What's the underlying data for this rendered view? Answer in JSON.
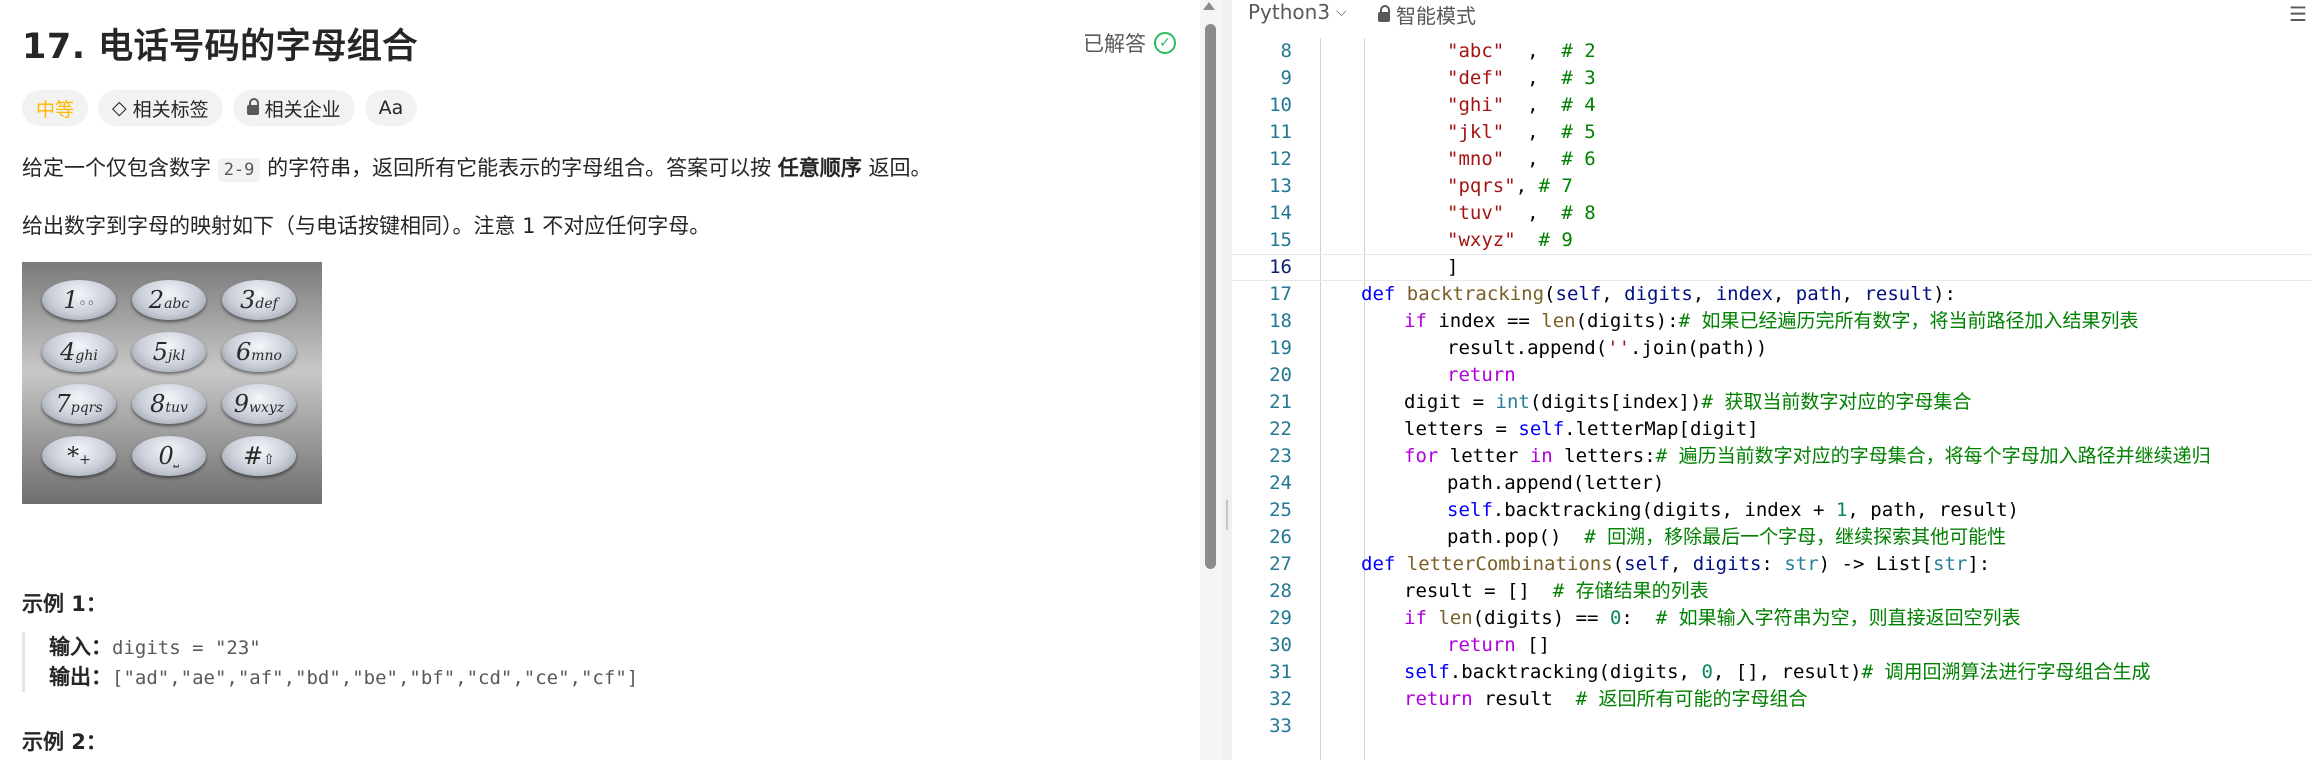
{
  "problem": {
    "title": "17. 电话号码的字母组合",
    "solved_label": "已解答",
    "tags": [
      "中等",
      "相关标签",
      "相关企业",
      "Aa"
    ],
    "description_parts": [
      "给定一个仅包含数字 ",
      "2-9",
      " 的字符串，返回所有它能表示的字母组合。答案可以按 ",
      "任意顺序",
      " 返回。"
    ],
    "mapping_note": "给出数字到字母的映射如下（与电话按键相同）。注意 1 不对应任何字母。",
    "keypad": [
      {
        "n": "1",
        "l": "◦◦"
      },
      {
        "n": "2",
        "l": "abc"
      },
      {
        "n": "3",
        "l": "def"
      },
      {
        "n": "4",
        "l": "ghi"
      },
      {
        "n": "5",
        "l": "jkl"
      },
      {
        "n": "6",
        "l": "mno"
      },
      {
        "n": "7",
        "l": "pqrs"
      },
      {
        "n": "8",
        "l": "tuv"
      },
      {
        "n": "9",
        "l": "wxyz"
      },
      {
        "n": "*",
        "l": "+"
      },
      {
        "n": "0",
        "l": "⎵"
      },
      {
        "n": "#",
        "l": "⇧"
      }
    ],
    "example1_title": "示例 1：",
    "example1_input_label": "输入：",
    "example1_input_value": "digits = \"23\"",
    "example1_output_label": "输出：",
    "example1_output_value": "[\"ad\",\"ae\",\"af\",\"bd\",\"be\",\"bf\",\"cd\",\"ce\",\"cf\"]",
    "example2_title": "示例 2："
  },
  "editor": {
    "language": "Python3",
    "mode_label": "智能模式",
    "current_line": 16,
    "lines": [
      {
        "no": 8,
        "indent": 3,
        "tokens": [
          [
            "str",
            "\"abc\""
          ],
          [
            "",
            "  ,  "
          ],
          [
            "cm",
            "# 2"
          ]
        ]
      },
      {
        "no": 9,
        "indent": 3,
        "tokens": [
          [
            "str",
            "\"def\""
          ],
          [
            "",
            "  ,  "
          ],
          [
            "cm",
            "# 3"
          ]
        ]
      },
      {
        "no": 10,
        "indent": 3,
        "tokens": [
          [
            "str",
            "\"ghi\""
          ],
          [
            "",
            "  ,  "
          ],
          [
            "cm",
            "# 4"
          ]
        ]
      },
      {
        "no": 11,
        "indent": 3,
        "tokens": [
          [
            "str",
            "\"jkl\""
          ],
          [
            "",
            "  ,  "
          ],
          [
            "cm",
            "# 5"
          ]
        ]
      },
      {
        "no": 12,
        "indent": 3,
        "tokens": [
          [
            "str",
            "\"mno\""
          ],
          [
            "",
            "  ,  "
          ],
          [
            "cm",
            "# 6"
          ]
        ]
      },
      {
        "no": 13,
        "indent": 3,
        "tokens": [
          [
            "str",
            "\"pqrs\""
          ],
          [
            "",
            ", "
          ],
          [
            "cm",
            "# 7"
          ]
        ]
      },
      {
        "no": 14,
        "indent": 3,
        "tokens": [
          [
            "str",
            "\"tuv\""
          ],
          [
            "",
            "  ,  "
          ],
          [
            "cm",
            "# 8"
          ]
        ]
      },
      {
        "no": 15,
        "indent": 3,
        "tokens": [
          [
            "str",
            "\"wxyz\""
          ],
          [
            "",
            "  "
          ],
          [
            "cm",
            "# 9"
          ]
        ]
      },
      {
        "no": 16,
        "indent": 3,
        "tokens": [
          [
            "",
            "]"
          ]
        ]
      },
      {
        "no": 17,
        "indent": 1,
        "tokens": [
          [
            "kw",
            "def "
          ],
          [
            "fn",
            "backtracking"
          ],
          [
            "",
            "("
          ],
          [
            "var",
            "self"
          ],
          [
            "",
            ", "
          ],
          [
            "var",
            "digits"
          ],
          [
            "",
            ", "
          ],
          [
            "var",
            "index"
          ],
          [
            "",
            ", "
          ],
          [
            "var",
            "path"
          ],
          [
            "",
            ", "
          ],
          [
            "var",
            "result"
          ],
          [
            "",
            "):"
          ]
        ]
      },
      {
        "no": 18,
        "indent": 2,
        "tokens": [
          [
            "ctl",
            "if "
          ],
          [
            "",
            "index == "
          ],
          [
            "fn",
            "len"
          ],
          [
            "",
            "(digits):"
          ],
          [
            "cm",
            "# 如果已经遍历完所有数字，将当前路径加入结果列表"
          ]
        ]
      },
      {
        "no": 19,
        "indent": 3,
        "tokens": [
          [
            "",
            "result.append("
          ],
          [
            "str",
            "''"
          ],
          [
            "",
            ".join(path))"
          ]
        ]
      },
      {
        "no": 20,
        "indent": 3,
        "tokens": [
          [
            "ctl",
            "return"
          ]
        ]
      },
      {
        "no": 21,
        "indent": 2,
        "tokens": [
          [
            "",
            "digit = "
          ],
          [
            "bi",
            "int"
          ],
          [
            "",
            "(digits[index])"
          ],
          [
            "cm",
            "# 获取当前数字对应的字母集合"
          ]
        ]
      },
      {
        "no": 22,
        "indent": 2,
        "tokens": [
          [
            "",
            "letters = "
          ],
          [
            "kw",
            "self"
          ],
          [
            "",
            ".letterMap[digit]"
          ]
        ]
      },
      {
        "no": 23,
        "indent": 2,
        "tokens": [
          [
            "ctl",
            "for "
          ],
          [
            "",
            "letter "
          ],
          [
            "ctl",
            "in "
          ],
          [
            "",
            "letters:"
          ],
          [
            "cm",
            "# 遍历当前数字对应的字母集合，将每个字母加入路径并继续递归"
          ]
        ]
      },
      {
        "no": 24,
        "indent": 3,
        "tokens": [
          [
            "",
            "path.append(letter)"
          ]
        ]
      },
      {
        "no": 25,
        "indent": 3,
        "tokens": [
          [
            "kw",
            "self"
          ],
          [
            "",
            ".backtracking(digits, index + "
          ],
          [
            "num",
            "1"
          ],
          [
            "",
            ", path, result)"
          ]
        ]
      },
      {
        "no": 26,
        "indent": 3,
        "tokens": [
          [
            "",
            "path.pop()  "
          ],
          [
            "cm",
            "# 回溯，移除最后一个字母，继续探索其他可能性"
          ]
        ]
      },
      {
        "no": 27,
        "indent": 1,
        "tokens": [
          [
            "kw",
            "def "
          ],
          [
            "fn",
            "letterCombinations"
          ],
          [
            "",
            "("
          ],
          [
            "var",
            "self"
          ],
          [
            "",
            ", "
          ],
          [
            "var",
            "digits"
          ],
          [
            "",
            ": "
          ],
          [
            "bi",
            "str"
          ],
          [
            "",
            ") -> List["
          ],
          [
            "bi",
            "str"
          ],
          [
            "",
            "]:"
          ]
        ]
      },
      {
        "no": 28,
        "indent": 2,
        "tokens": [
          [
            "",
            "result = []  "
          ],
          [
            "cm",
            "# 存储结果的列表"
          ]
        ]
      },
      {
        "no": 29,
        "indent": 2,
        "tokens": [
          [
            "ctl",
            "if "
          ],
          [
            "fn",
            "len"
          ],
          [
            "",
            "(digits) == "
          ],
          [
            "num",
            "0"
          ],
          [
            "",
            ":  "
          ],
          [
            "cm",
            "# 如果输入字符串为空，则直接返回空列表"
          ]
        ]
      },
      {
        "no": 30,
        "indent": 3,
        "tokens": [
          [
            "ctl",
            "return "
          ],
          [
            "",
            "[]"
          ]
        ]
      },
      {
        "no": 31,
        "indent": 2,
        "tokens": [
          [
            "kw",
            "self"
          ],
          [
            "",
            ".backtracking(digits, "
          ],
          [
            "num",
            "0"
          ],
          [
            "",
            ", [], result)"
          ],
          [
            "cm",
            "# 调用回溯算法进行字母组合生成"
          ]
        ]
      },
      {
        "no": 32,
        "indent": 2,
        "tokens": [
          [
            "ctl",
            "return "
          ],
          [
            "",
            "result  "
          ],
          [
            "cm",
            "# 返回所有可能的字母组合"
          ]
        ]
      },
      {
        "no": 33,
        "indent": 0,
        "tokens": []
      }
    ]
  }
}
